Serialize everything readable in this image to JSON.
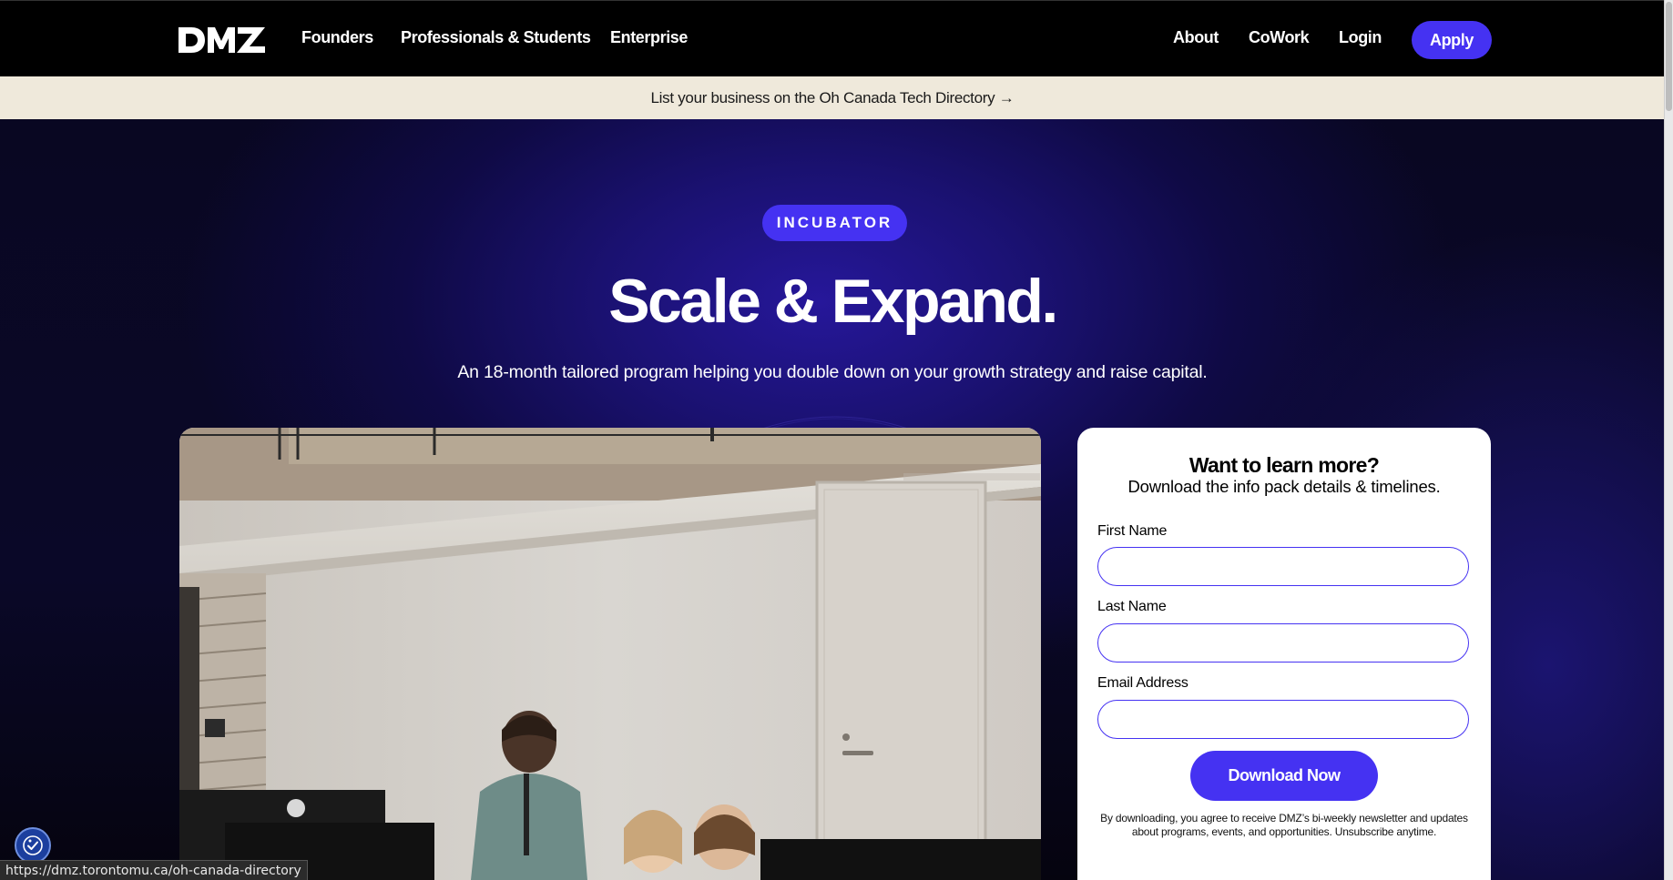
{
  "nav": {
    "logo_alt": "DMZ",
    "links": [
      "Founders",
      "Professionals & Students",
      "Enterprise"
    ],
    "right_links": [
      "About",
      "CoWork",
      "Login"
    ],
    "apply_label": "Apply",
    "accent_color": "#4532f2"
  },
  "announcement": {
    "text": "List your business on the Oh Canada Tech Directory →"
  },
  "hero": {
    "badge": "INCUBATOR",
    "title": "Scale & Expand.",
    "subtitle": "An 18-month tailored program helping you double down on your growth strategy and raise capital."
  },
  "form": {
    "title": "Want to learn more?",
    "subtitle": "Download the info pack details & timelines.",
    "first_name_label": "First Name",
    "first_name_value": "",
    "last_name_label": "Last Name",
    "last_name_value": "",
    "email_label": "Email Address",
    "email_value": "",
    "download_label": "Download Now",
    "disclaimer": "By downloading, you agree to receive DMZ’s bi-weekly newsletter and updates about programs, events, and opportunities. Unsubscribe anytime."
  },
  "status_bar": {
    "url": "https://dmz.torontomu.ca/oh-canada-directory"
  },
  "icons": {
    "accessibility": "accessibility-icon",
    "logo": "dmz-logo-icon"
  }
}
